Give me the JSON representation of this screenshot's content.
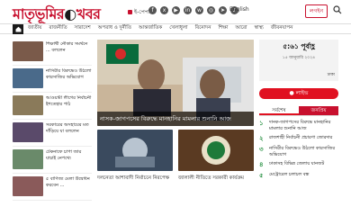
{
  "header": {
    "logo_main": "মাতৃভূমির",
    "logo_sub": "খবর",
    "epaper": "ই-পেপার",
    "language": "English",
    "login": "লগইন"
  },
  "nav": {
    "items": [
      "জাতীয়",
      "রাজনীতি",
      "সারাদেশ",
      "অপরাধ ও দুর্নীতি",
      "আন্তর্জাতিক",
      "খেলাধুলা",
      "বিনোদন",
      "শিক্ষা",
      "আরো",
      "স্বাস্থ্য",
      "জীবনযাপন"
    ]
  },
  "left_news": [
    "শিক্ষার্থী নৌকার সমর্থনে ... বললেন",
    "নাসিরীর বিরুদ্ধেও উঠলো কারসাজির অভিযোগ",
    "আওয়ামী লীগের নির্বাচনী ইশতেহার পাঠ",
    "সরকারের অসহায়ের মত দাঁড়িয়ে যা বললেন",
    "টেকনাফে চাপা জার যাচাই নেপথ্যে",
    "৫ বাণিজ্য মেলা উদ্বোধন করবেন ..."
  ],
  "hero": {
    "caption": "নাসক-জাগপসের বিরুদ্ধে মানহানির মামলার শুনানি আজ"
  },
  "mid_cards": [
    {
      "text": "দলনেতা আশাবাদী নির্বাচনে নিরপেক্ষ"
    },
    {
      "text": "জালালী নীতিতে সরকারী কার্যক্রম"
    }
  ],
  "right": {
    "time": "৫:৬১ পূর্বাহ্ণ",
    "date": "১৫ জানুয়ারি ২০২৪",
    "location": "ঢাকা",
    "live_label": "● লাইভ",
    "tab_latest": "সর্বশেষ",
    "tab_popular": "জনপ্রিয়",
    "news": [
      {
        "num": "১",
        "text": "দানক-জাগপসের বিরুদ্ধে মানহানির মামলার শুনানি আজ"
      },
      {
        "num": "২",
        "text": "রাজশাহী নির্বাচনী প্রচারণা জোরদার"
      },
      {
        "num": "৩",
        "text": "নাসিরীর বিরুদ্ধেও উঠলো কারসাজির অভিযোগ"
      },
      {
        "num": "৪",
        "text": "ঢাকাসহ বিভিন্ন জেলায় যানজট"
      },
      {
        "num": "৫",
        "text": "মেট্রোরেল চলাচল বন্ধ"
      }
    ]
  },
  "colors": {
    "brand": "#c8102e",
    "live": "#e01020",
    "accent_green": "#1e8c3a"
  }
}
